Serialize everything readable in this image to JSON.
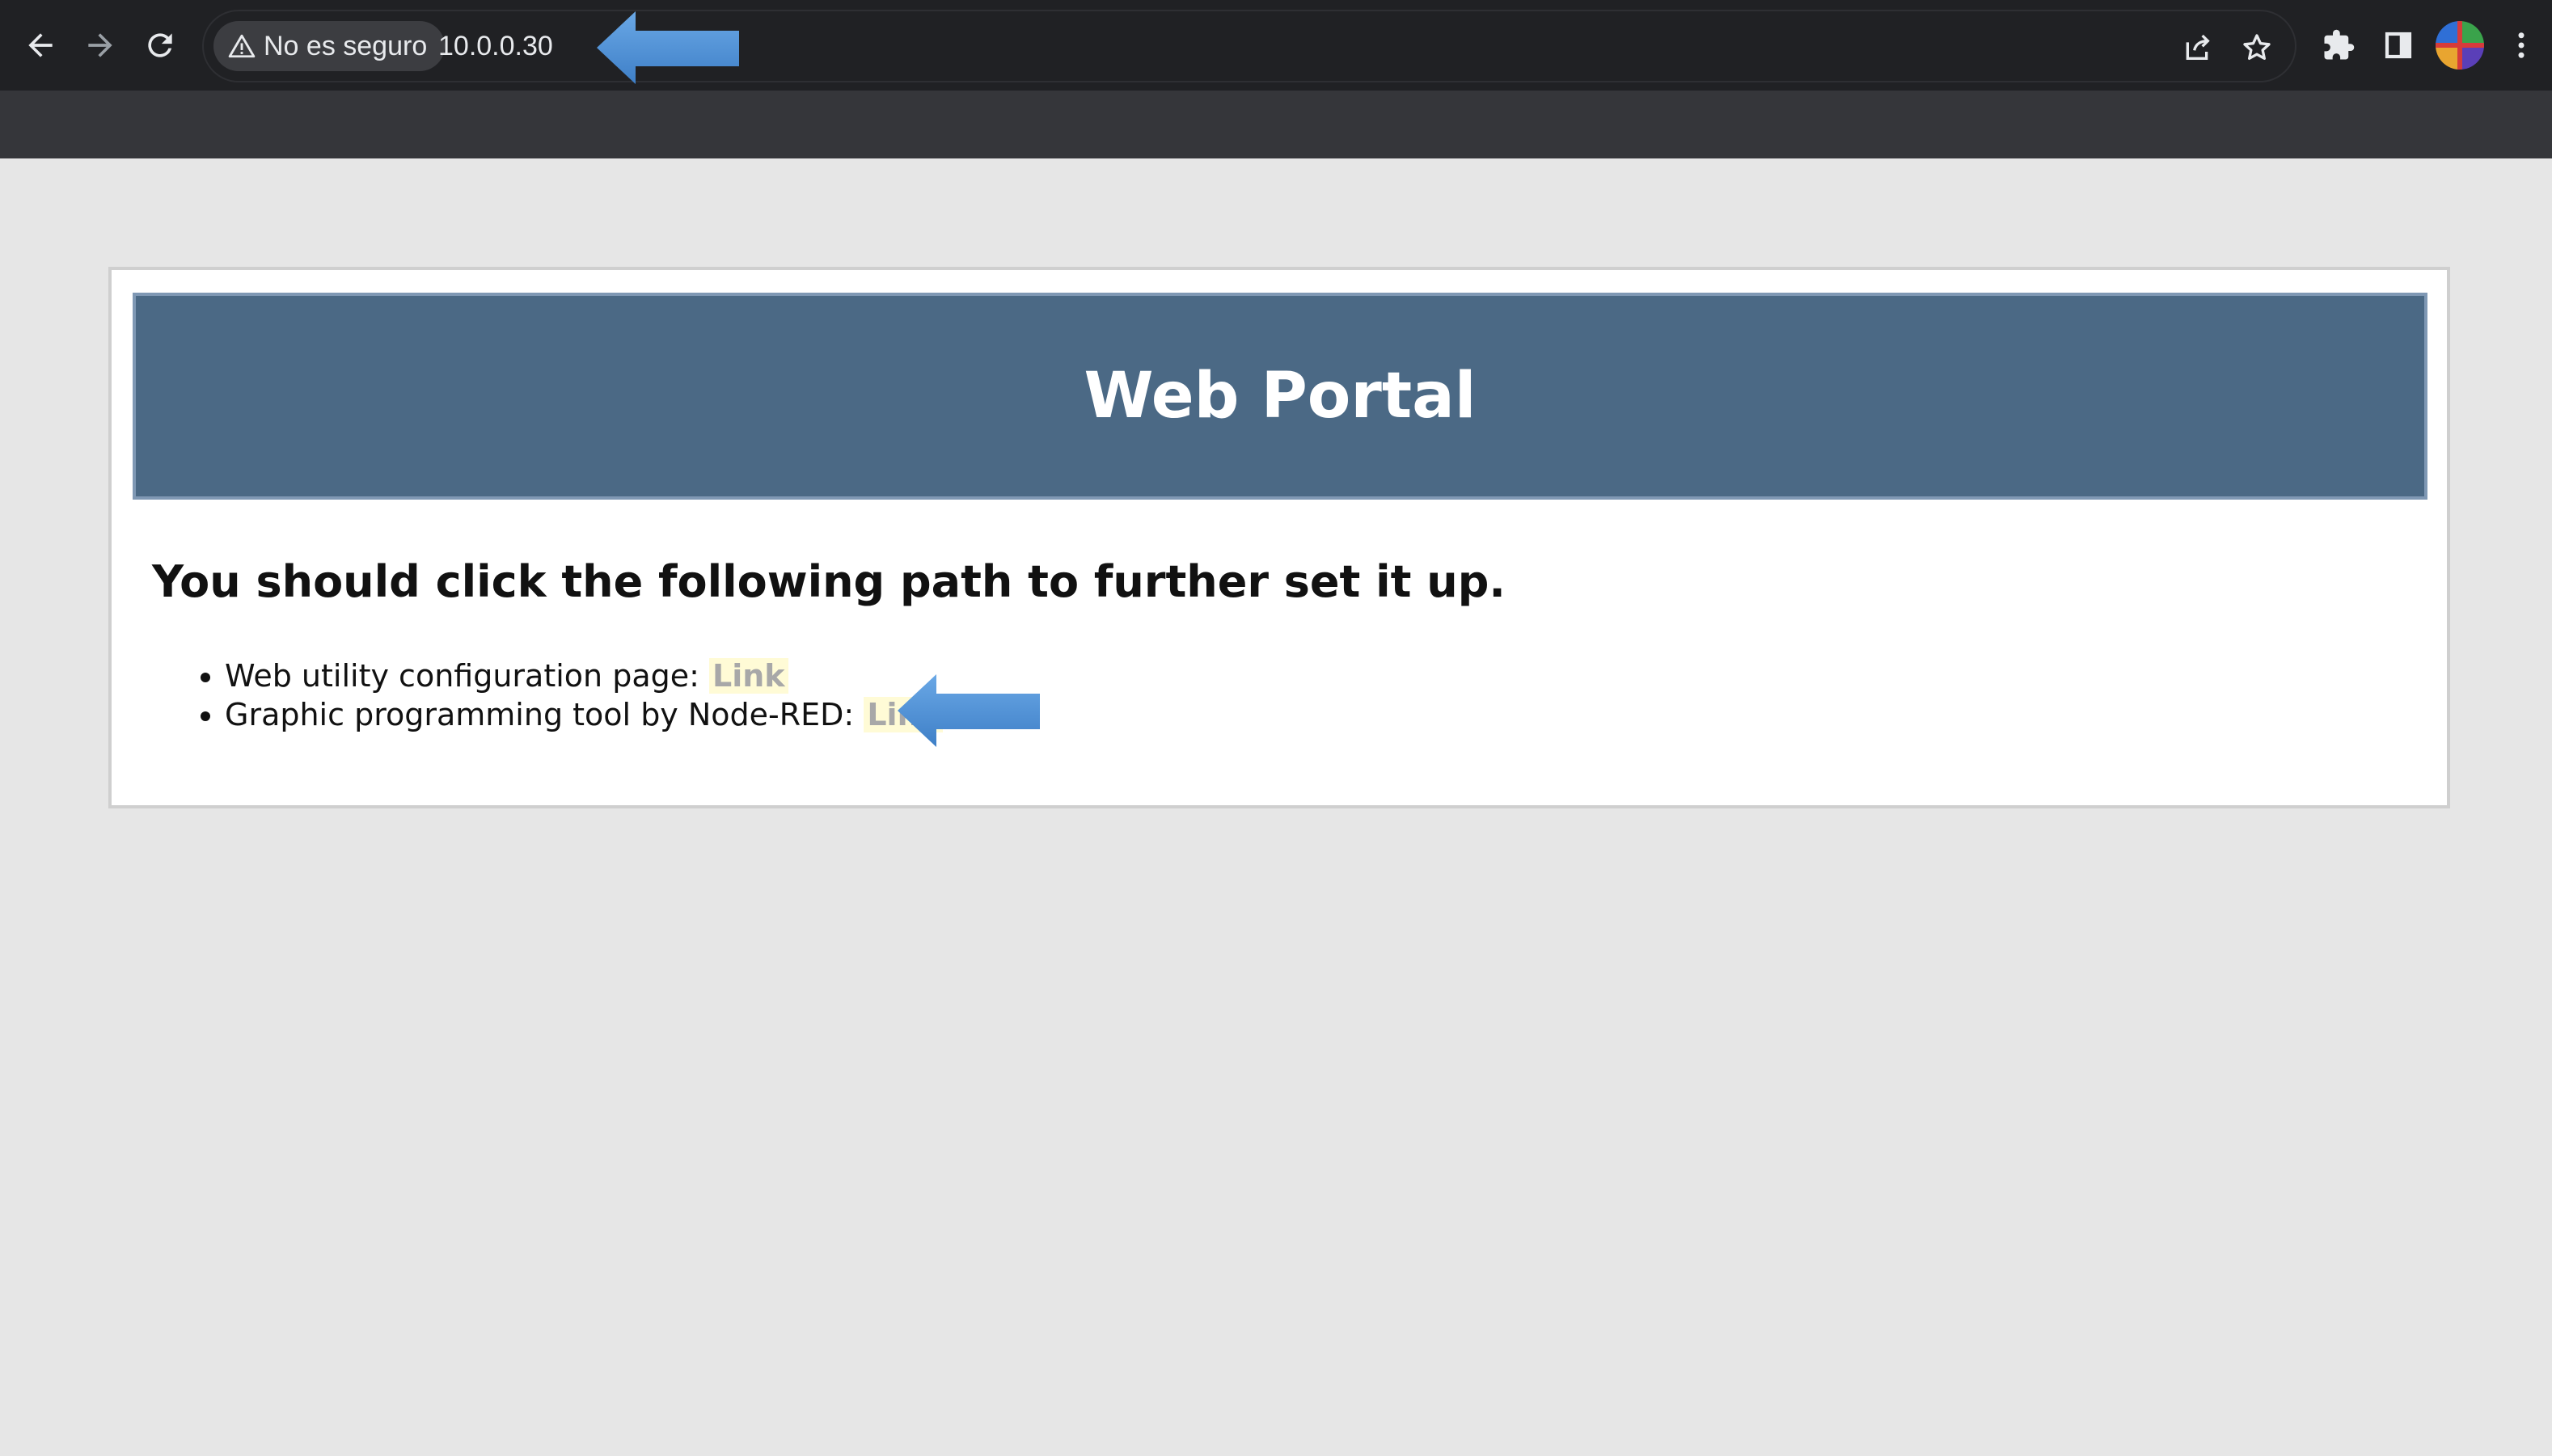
{
  "browser": {
    "security_label": "No es seguro",
    "url": "10.0.0.30",
    "icons": {
      "back": "back-arrow-icon",
      "forward": "forward-arrow-icon",
      "reload": "reload-icon",
      "warning": "warning-icon",
      "share": "share-icon",
      "bookmark": "star-icon",
      "extensions": "puzzle-icon",
      "side_panel": "side-panel-icon",
      "profile": "profile-avatar",
      "menu": "kebab-menu-icon"
    },
    "colors": {
      "toolbar": "#202124",
      "tabstrip": "#35363a"
    }
  },
  "page": {
    "header_title": "Web Portal",
    "heading": "You should click the following path to further set it up.",
    "items": [
      {
        "label": "Web utility configuration page: ",
        "link": "Link"
      },
      {
        "label": "Graphic programming tool by Node-RED: ",
        "link": "Link"
      }
    ],
    "colors": {
      "header_bg": "#4b6985",
      "link_highlight": "#fffbd6",
      "link_text": "#a8a8a8",
      "annotation_arrow": "#4a8fd4"
    }
  }
}
